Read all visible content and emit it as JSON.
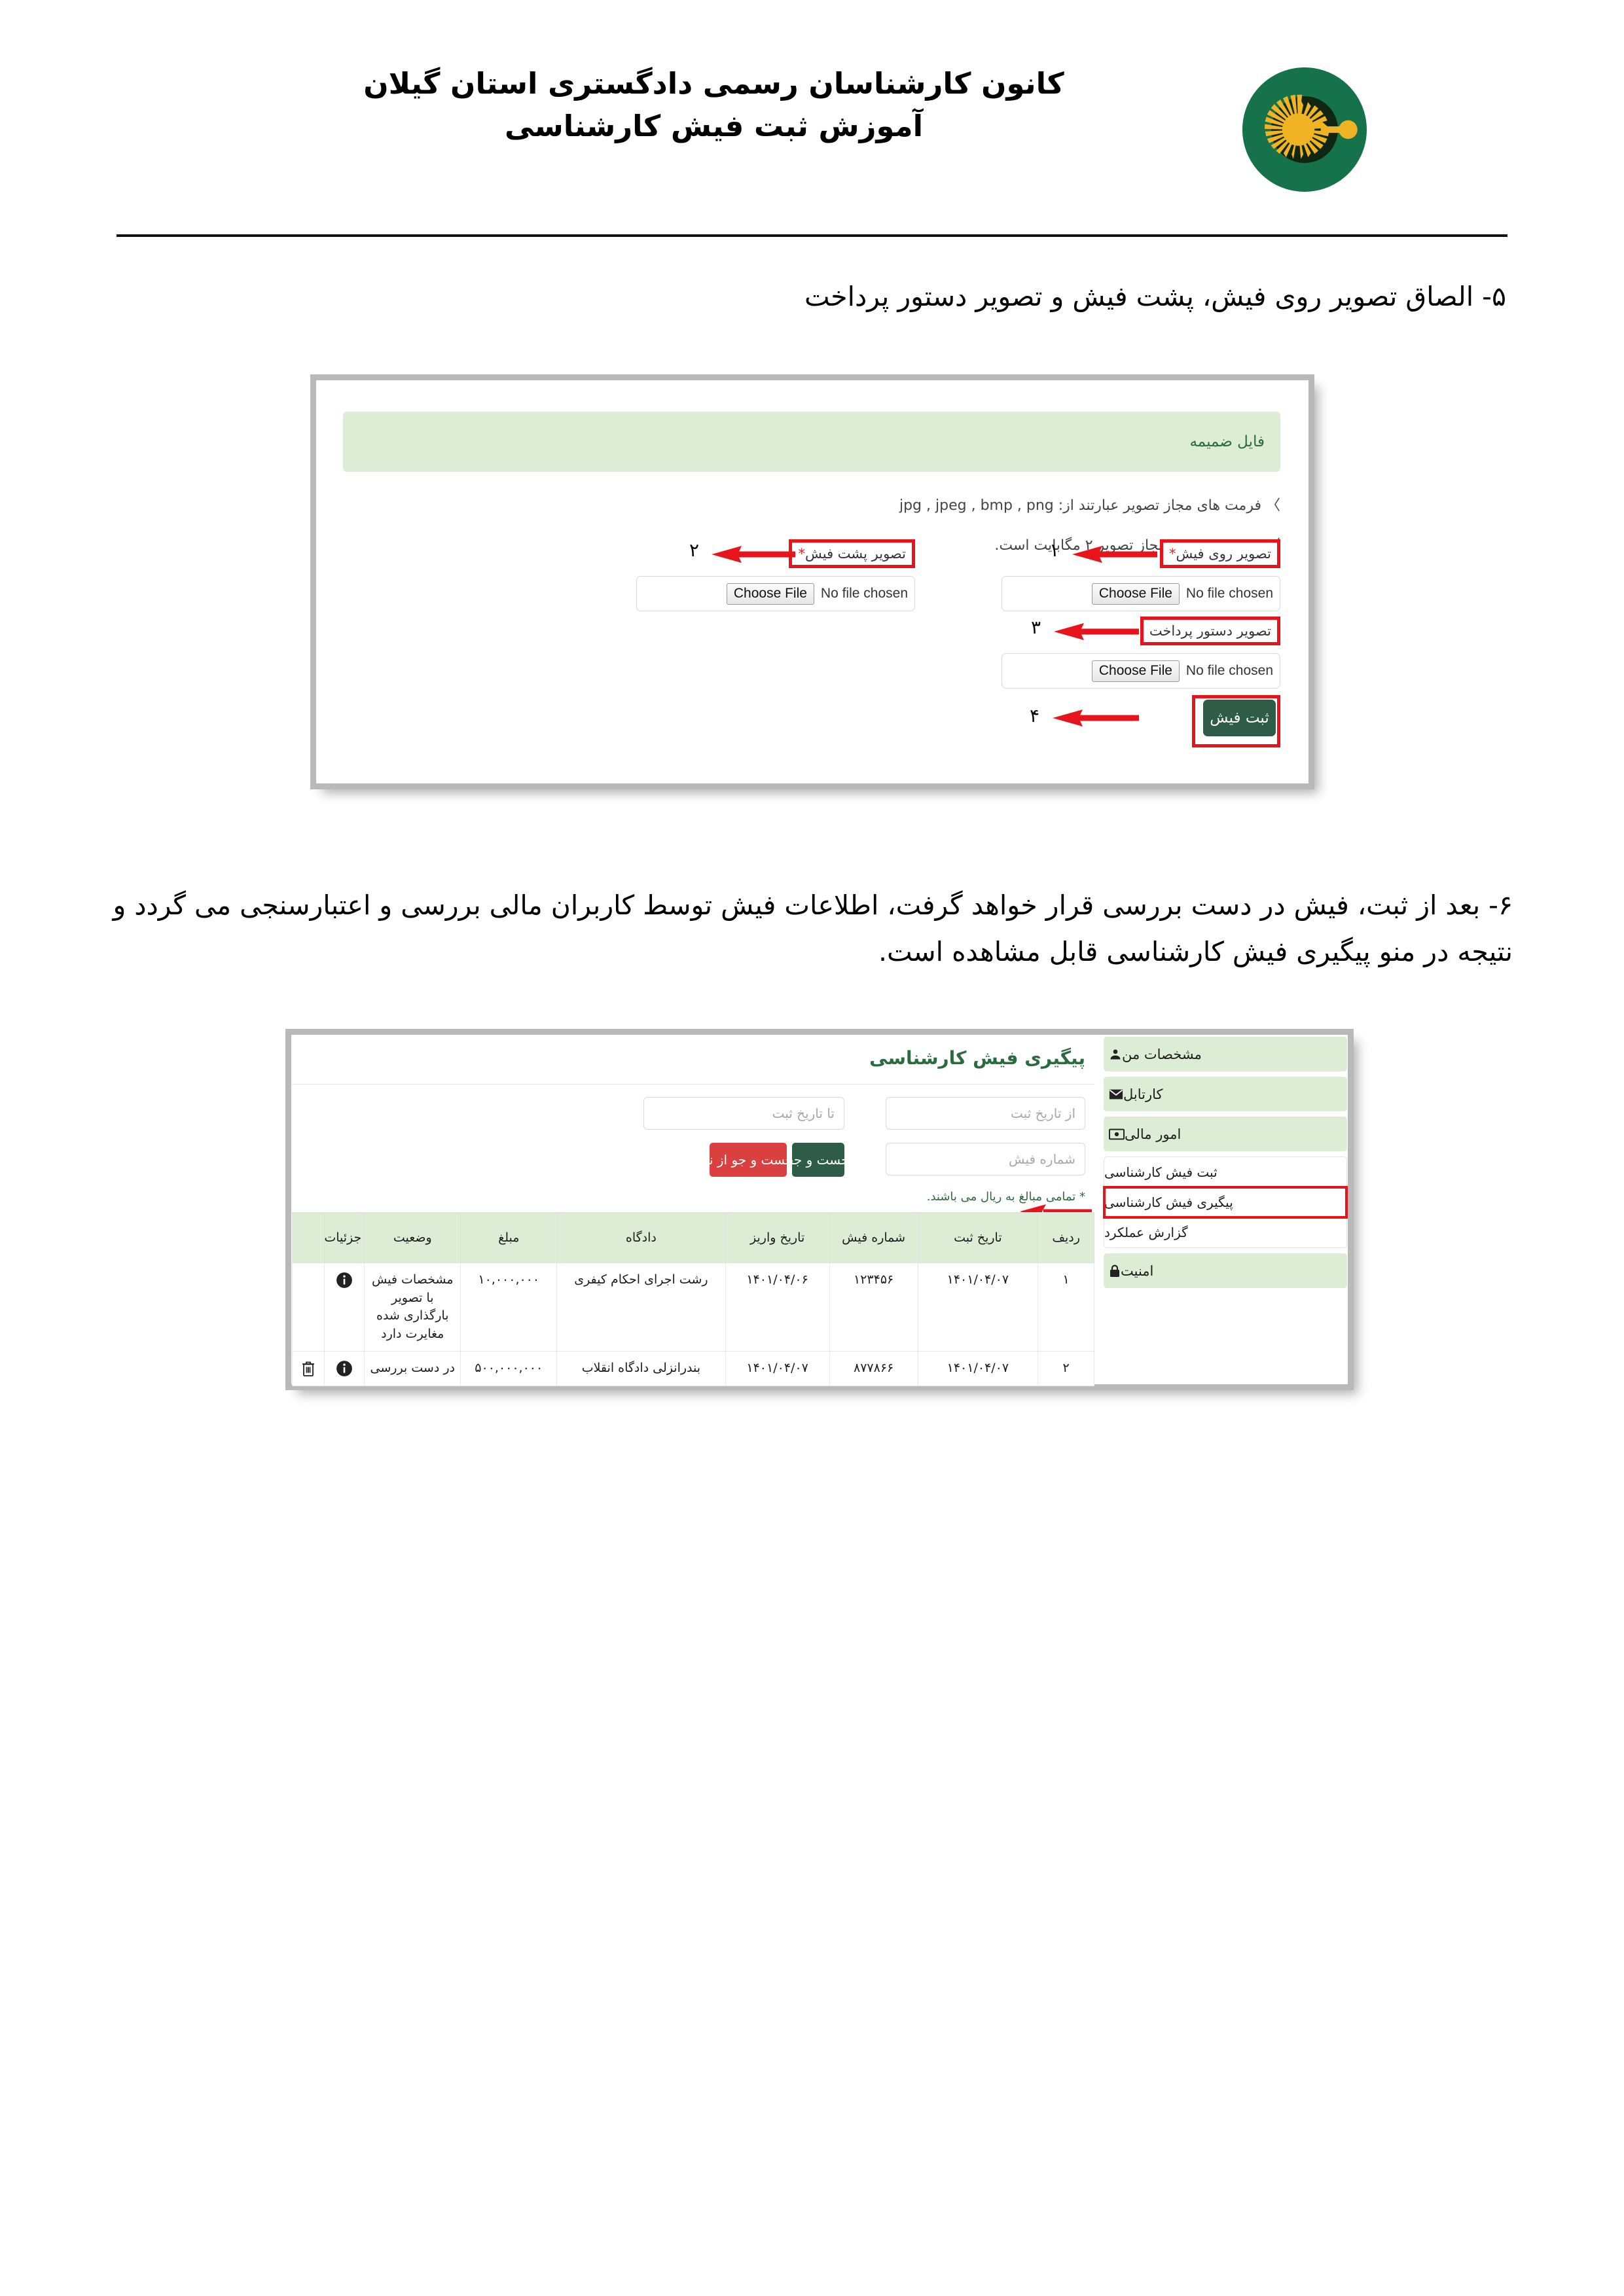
{
  "header": {
    "title_line1": "کانون کارشناسان رسمی دادگستری استان گیلان",
    "title_line2": "آموزش ثبت فیش کارشناسی",
    "logo_name": "kanoon-logo",
    "brand_green": "#15724b",
    "brand_gold": "#f0b323",
    "brand_dark": "#102611"
  },
  "steps": {
    "step5": "۵- الصاق تصویر روی فیش، پشت فیش و تصویر دستور پرداخت",
    "step6": "۶- بعد از ثبت، فیش در دست بررسی قرار خواهد گرفت، اطلاعات فیش توسط کاربران مالی بررسی و اعتبارسنجی می گردد و نتیجه در منو پیگیری فیش کارشناسی قابل مشاهده است."
  },
  "shot1": {
    "panel_header": "فایل ضمیمه",
    "hints": [
      "〉 فرمت های مجاز تصویر عبارتند از: jpg , jpeg , bmp , png",
      "〉 بیش ترین حجم مجاز تصویر ۲ مگابایت است."
    ],
    "fields": [
      {
        "label": "تصویر روی فیش",
        "required": true,
        "annotation": "۱",
        "button": "Choose File",
        "status": "No file chosen"
      },
      {
        "label": "تصویر پشت فیش",
        "required": true,
        "annotation": "۲",
        "button": "Choose File",
        "status": "No file chosen"
      },
      {
        "label": "تصویر دستور پرداخت",
        "required": false,
        "annotation": "۳",
        "button": "Choose File",
        "status": "No file chosen"
      }
    ],
    "submit": {
      "label": "ثبت فیش",
      "annotation": "۴",
      "color": "#2e5c47"
    },
    "highlight_color": "#e8141b",
    "panel_header_bg": "#dcecd5"
  },
  "shot2": {
    "title": "پیگیری فیش کارشناسی",
    "sidebar": [
      {
        "label": "مشخصات من",
        "icon": "person-icon",
        "type": "block"
      },
      {
        "label": "کارتابل",
        "icon": "envelope-icon",
        "type": "block"
      },
      {
        "label": "امور مالی",
        "icon": "banknote-icon",
        "type": "block"
      }
    ],
    "sub_items": [
      {
        "label": "ثبت فیش کارشناسی",
        "highlight": false
      },
      {
        "label": "پیگیری فیش کارشناسی",
        "highlight": true
      },
      {
        "label": "گزارش عملکرد",
        "highlight": false
      }
    ],
    "sidebar_last": {
      "label": "امنیت",
      "icon": "lock-icon",
      "type": "block"
    },
    "search": {
      "from_date_placeholder": "از تاریخ ثبت",
      "to_date_placeholder": "تا تاریخ ثبت",
      "receipt_no_placeholder": "شماره فیش",
      "search_button": "جست و جو",
      "reset_button": "جست و جو از نو",
      "search_color": "#2e5c47",
      "reset_color": "#d9403f"
    },
    "note": "* تمامی مبالغ به ریال می باشند.",
    "table": {
      "columns": [
        "ردیف",
        "تاریخ ثبت",
        "شماره فیش",
        "تاریخ واریز",
        "دادگاه",
        "مبلغ",
        "وضعیت",
        "جزئیات",
        ""
      ],
      "rows": [
        {
          "row": "۱",
          "register_date": "۱۴۰۱/۰۴/۰۷",
          "receipt_no": "۱۲۳۴۵۶",
          "deposit_date": "۱۴۰۱/۰۴/۰۶",
          "court": "رشت اجرای احکام کیفری",
          "amount": "۱۰,۰۰۰,۰۰۰",
          "status": "مشخصات فیش با تصویر بارگذاری شده مغایرت دارد",
          "status_color": "#e02020",
          "details_icon": "info-icon",
          "delete_icon": ""
        },
        {
          "row": "۲",
          "register_date": "۱۴۰۱/۰۴/۰۷",
          "receipt_no": "۸۷۷۸۶۶",
          "deposit_date": "۱۴۰۱/۰۴/۰۷",
          "court": "بندرانزلی دادگاه انقلاب",
          "amount": "۵۰۰,۰۰۰,۰۰۰",
          "status": "در دست بررسی",
          "status_color": "#2626c8",
          "details_icon": "info-icon",
          "delete_icon": "trash-icon"
        }
      ]
    },
    "header_bg": "#dcecd5",
    "highlight_color": "#e8141b"
  }
}
